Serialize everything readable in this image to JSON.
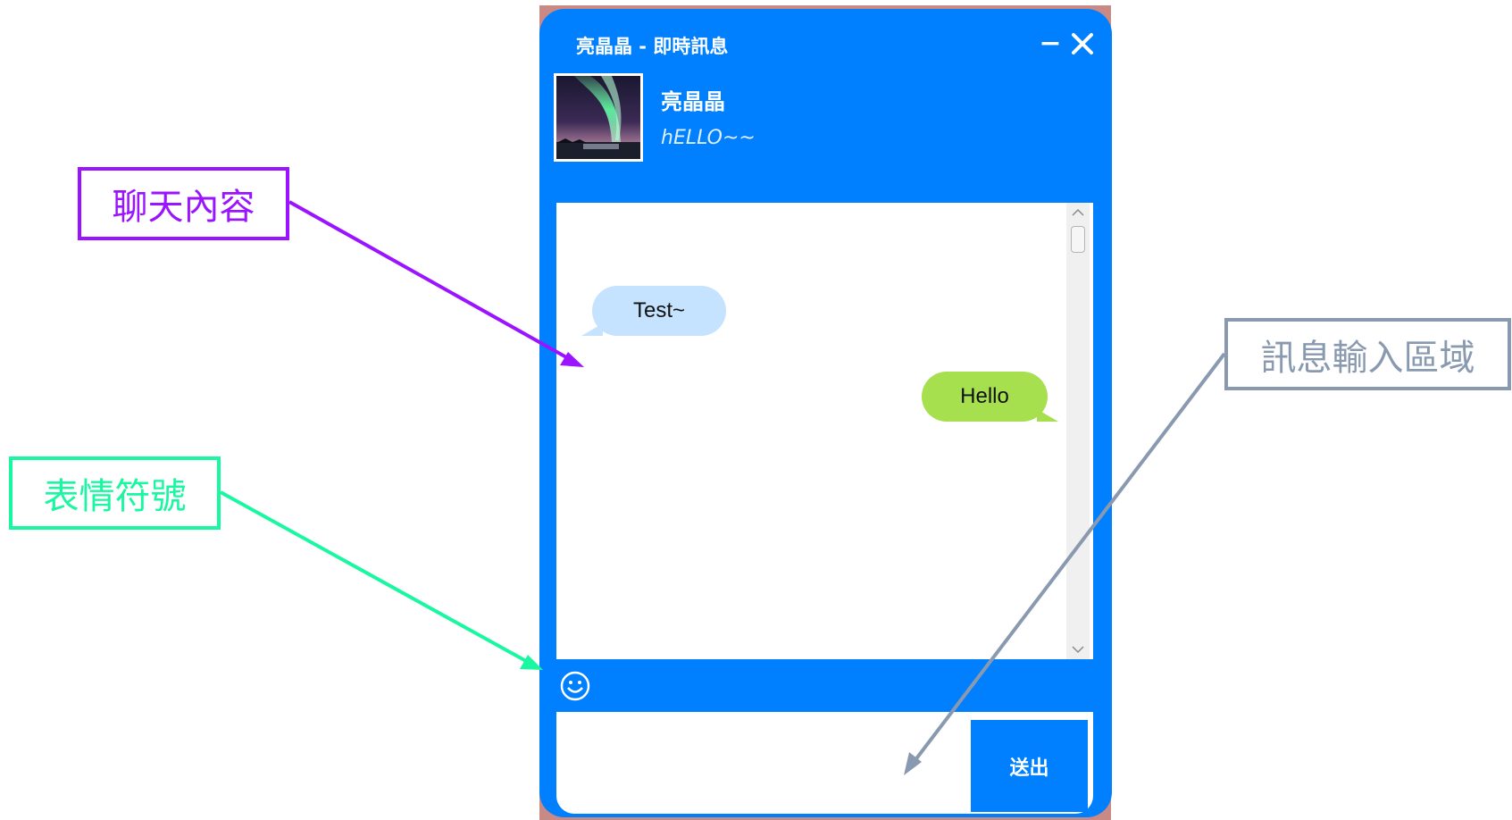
{
  "window": {
    "title": "亮晶晶 - 即時訊息",
    "minimize_label": "−"
  },
  "contact": {
    "name": "亮晶晶",
    "status": "hELLO~~"
  },
  "messages": [
    {
      "direction": "incoming",
      "text": "Test~"
    },
    {
      "direction": "outgoing",
      "text": "Hello"
    }
  ],
  "composer": {
    "input_value": "",
    "send_label": "送出"
  },
  "annotations": {
    "chat_content": "聊天內容",
    "emoji": "表情符號",
    "input_area": "訊息輸入區域"
  },
  "colors": {
    "window_blue": "#0080ff",
    "incoming_bubble": "#c5e3ff",
    "outgoing_bubble": "#a6e04e",
    "callout_chat": "#9b14ff",
    "callout_emoji": "#19f7a1",
    "callout_input": "#8899b0"
  }
}
